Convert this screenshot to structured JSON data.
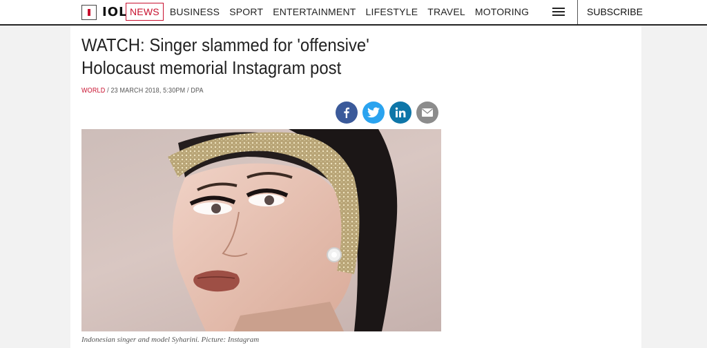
{
  "header": {
    "logo": "IOL",
    "nav": [
      "NEWS",
      "BUSINESS",
      "SPORT",
      "ENTERTAINMENT",
      "LIFESTYLE",
      "TRAVEL",
      "MOTORING"
    ],
    "active_nav": "NEWS",
    "subscribe": "SUBSCRIBE"
  },
  "article": {
    "headline": "WATCH: Singer slammed for 'offensive' Holocaust memorial Instagram post",
    "category": "WORLD",
    "meta": " / 23 MARCH 2018, 5:30PM / DPA",
    "share": [
      "facebook-icon",
      "twitter-icon",
      "linkedin-icon",
      "email-icon"
    ],
    "caption": "Indonesian singer and model Syharini. Picture: Instagram"
  },
  "colors": {
    "accent": "#c8102e",
    "facebook": "#3b5a9a",
    "twitter": "#2aa3ef",
    "linkedin": "#0e76a8",
    "email": "#8c8c8c"
  }
}
